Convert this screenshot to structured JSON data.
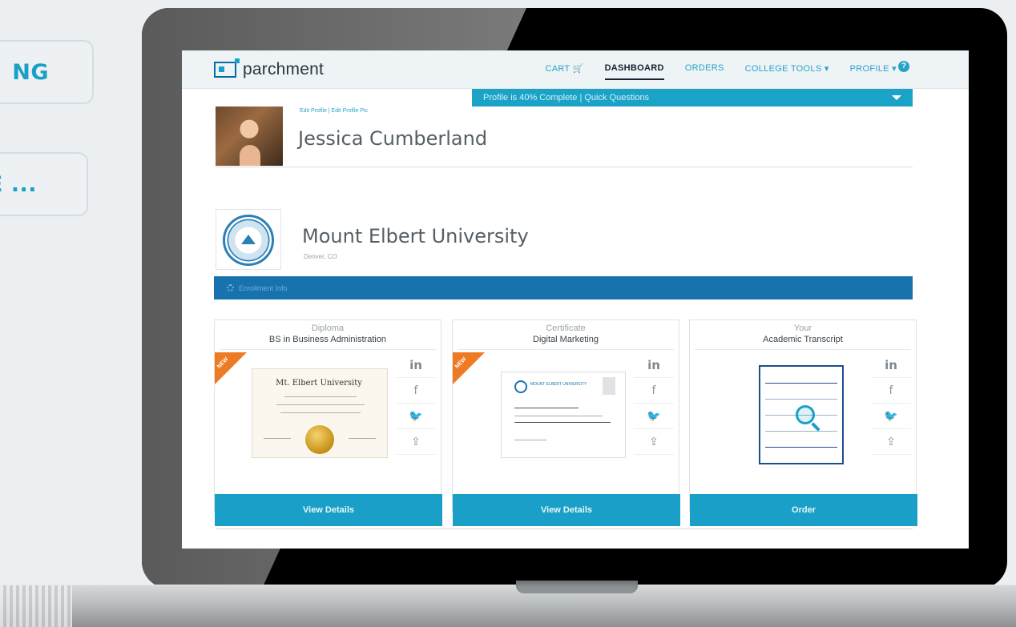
{
  "side_labels": [
    "NG",
    "E ..."
  ],
  "app": {
    "logo": "parchment",
    "nav": [
      "CART",
      "DASHBOARD",
      "ORDERS",
      "COLLEGE TOOLS",
      "PROFILE"
    ],
    "help": "?",
    "progress_text": "Profile is 40% Complete | Quick Questions"
  },
  "profile": {
    "links": "Edit Profile | Edit Profile Pic",
    "name": "Jessica Cumberland"
  },
  "institution": {
    "name": "Mount Elbert University",
    "location": "Denver, CO",
    "band_label": "Enrollment Info"
  },
  "cards": [
    {
      "type": "Diploma",
      "title": "BS in Business Administration",
      "ribbon": "NEW",
      "button": "View Details",
      "doc_heading": "Mt. Elbert University"
    },
    {
      "type": "Certificate",
      "title": "Digital Marketing",
      "ribbon": "NEW",
      "button": "View Details",
      "doc_heading": "MOUNT ELBERT UNIVERSITY"
    },
    {
      "type": "Your",
      "title": "Academic Transcript",
      "ribbon": "",
      "button": "Order"
    }
  ],
  "social": [
    "in",
    "f",
    "🐦",
    "⇪"
  ]
}
